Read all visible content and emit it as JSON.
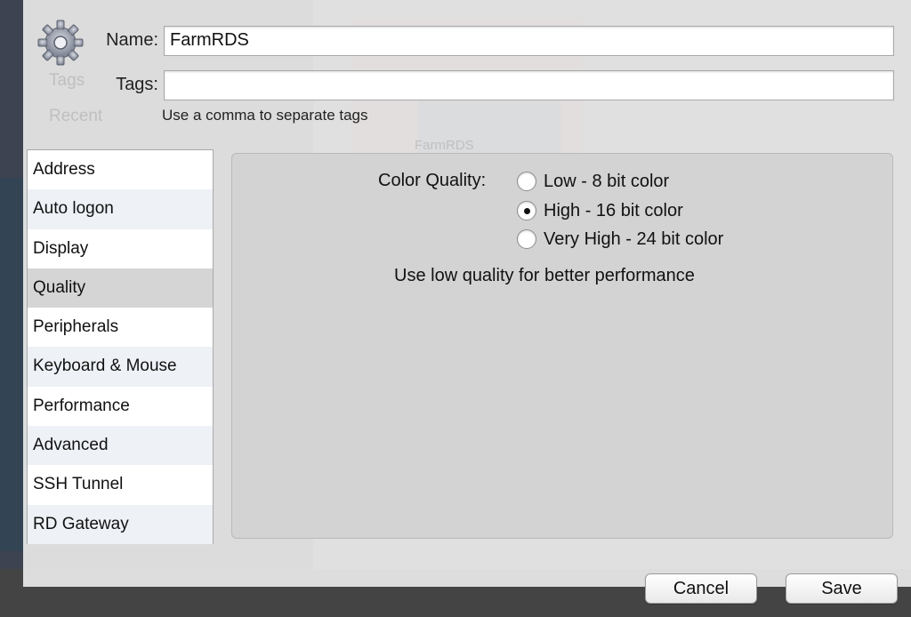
{
  "header": {
    "name_label": "Name:",
    "name_value": "FarmRDS",
    "tags_label": "Tags:",
    "tags_value": "",
    "tags_hint": "Use a comma to separate tags"
  },
  "background_ghost": {
    "tags": "Tags",
    "recent": "Recent",
    "tile": "FarmRDS"
  },
  "sidebar": {
    "items": [
      {
        "label": "Address"
      },
      {
        "label": "Auto logon"
      },
      {
        "label": "Display"
      },
      {
        "label": "Quality",
        "selected": true
      },
      {
        "label": "Peripherals"
      },
      {
        "label": "Keyboard & Mouse"
      },
      {
        "label": "Performance"
      },
      {
        "label": "Advanced"
      },
      {
        "label": "SSH Tunnel"
      },
      {
        "label": "RD Gateway"
      }
    ]
  },
  "quality": {
    "label": "Color Quality:",
    "options": [
      {
        "label": "Low - 8 bit color",
        "selected": false
      },
      {
        "label": "High - 16 bit color",
        "selected": true
      },
      {
        "label": "Very High - 24 bit color",
        "selected": false
      }
    ],
    "note": "Use low quality for better performance"
  },
  "buttons": {
    "cancel": "Cancel",
    "save": "Save"
  },
  "icons": {
    "settings": "gear-icon"
  }
}
